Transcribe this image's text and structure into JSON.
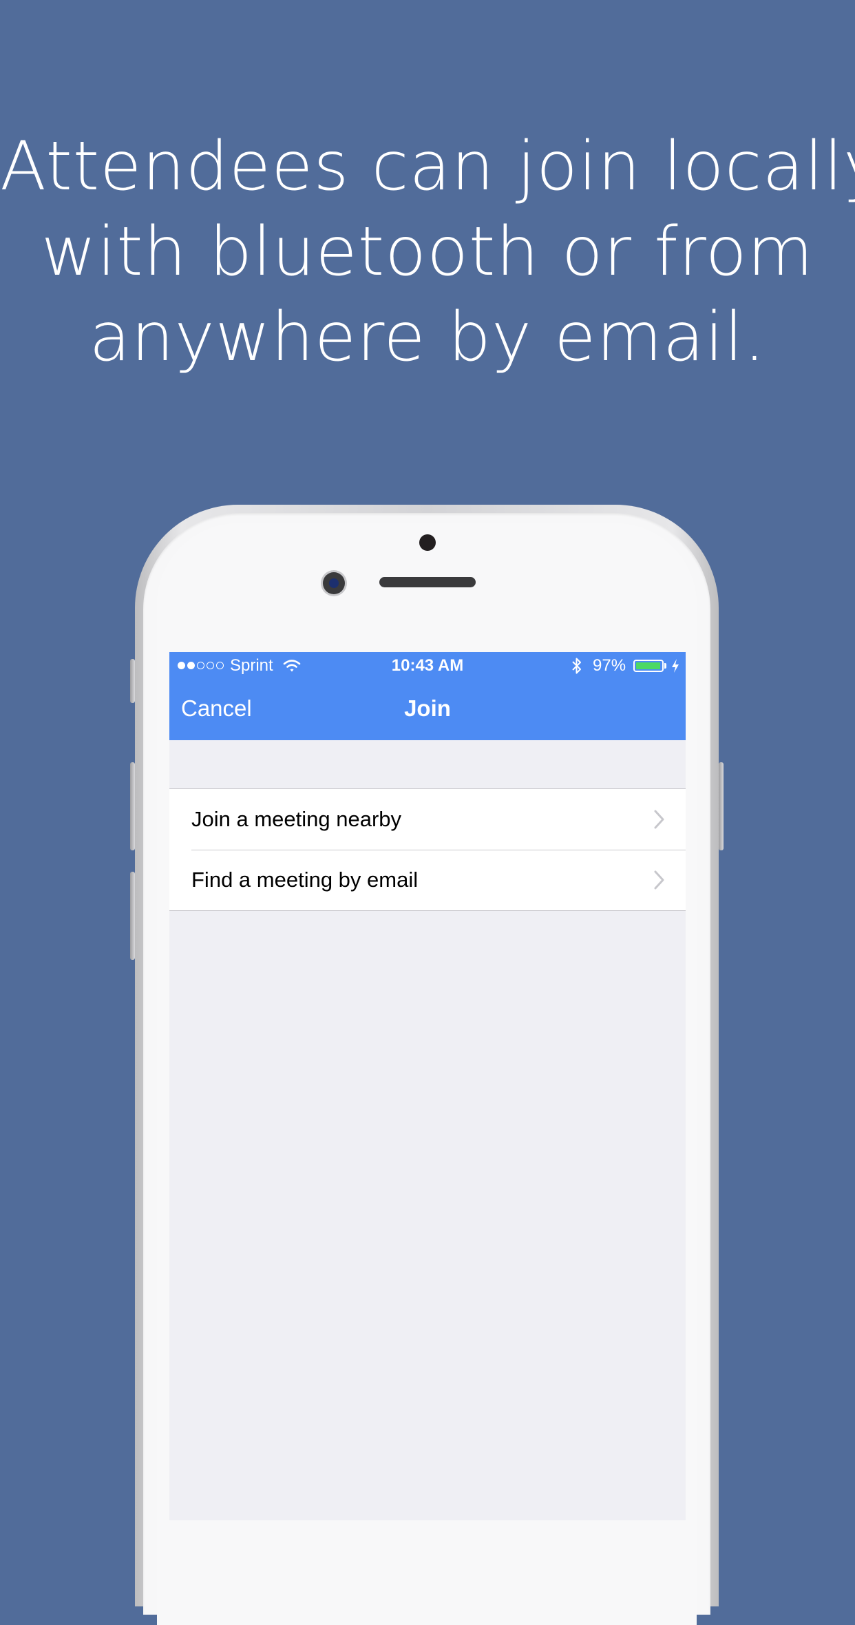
{
  "headline": {
    "line1": "Attendees can join locally",
    "line2": "with bluetooth or from",
    "line3": "anywhere by email."
  },
  "status_bar": {
    "carrier": "Sprint",
    "time": "10:43 AM",
    "battery_percent": "97%",
    "battery_level": 0.97,
    "signal_bars": 2,
    "signal_total": 5
  },
  "nav": {
    "cancel_label": "Cancel",
    "title": "Join"
  },
  "menu": {
    "items": [
      {
        "label": "Join a meeting nearby"
      },
      {
        "label": "Find a meeting by email"
      }
    ]
  },
  "colors": {
    "background": "#516c9a",
    "nav_bar": "#4d8bf3",
    "battery": "#4cd964",
    "screen_bg": "#efeff4"
  },
  "icons": [
    "wifi-icon",
    "bluetooth-icon",
    "battery-icon",
    "charging-icon",
    "chevron-right-icon"
  ]
}
